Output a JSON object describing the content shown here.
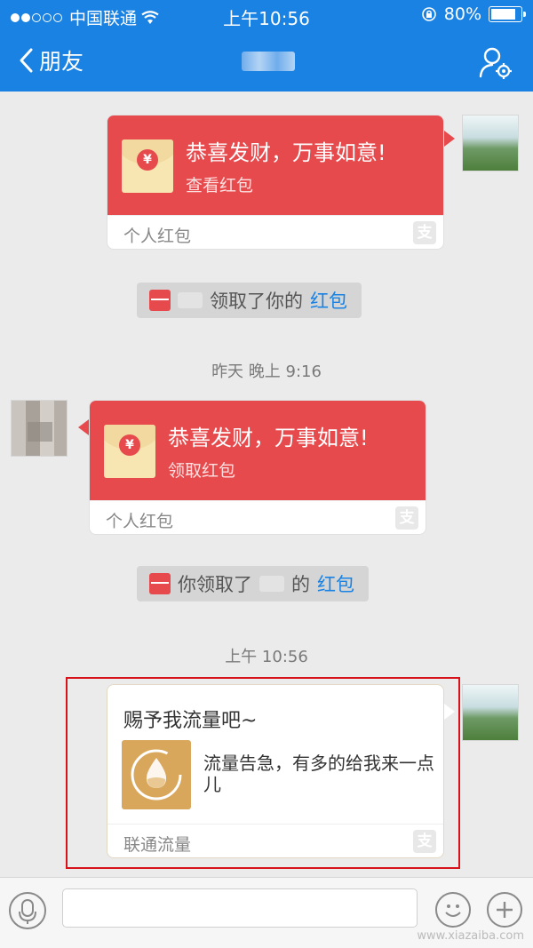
{
  "status_bar": {
    "carrier": "中国联通",
    "time": "上午10:56",
    "battery": "80%"
  },
  "nav": {
    "back_label": "朋友"
  },
  "messages": {
    "red1": {
      "title": "恭喜发财，万事如意!",
      "action": "查看红包",
      "footer": "个人红包"
    },
    "sys1": {
      "text_after": "领取了你的",
      "link": "红包"
    },
    "ts1": "昨天 晚上 9:16",
    "red2": {
      "title": "恭喜发财，万事如意!",
      "action": "领取红包",
      "footer": "个人红包"
    },
    "sys2": {
      "text_before": "你领取了",
      "text_after": "的",
      "link": "红包"
    },
    "ts2": "上午 10:56",
    "flow": {
      "title": "赐予我流量吧~",
      "desc": "流量告急，有多的给我来一点儿",
      "footer": "联通流量"
    }
  },
  "watermark": "www.xiazaiba.com",
  "colors": {
    "header": "#1a82e2",
    "redpacket": "#e64a4d",
    "highlight": "#d8121a",
    "link": "#1a82e2"
  }
}
